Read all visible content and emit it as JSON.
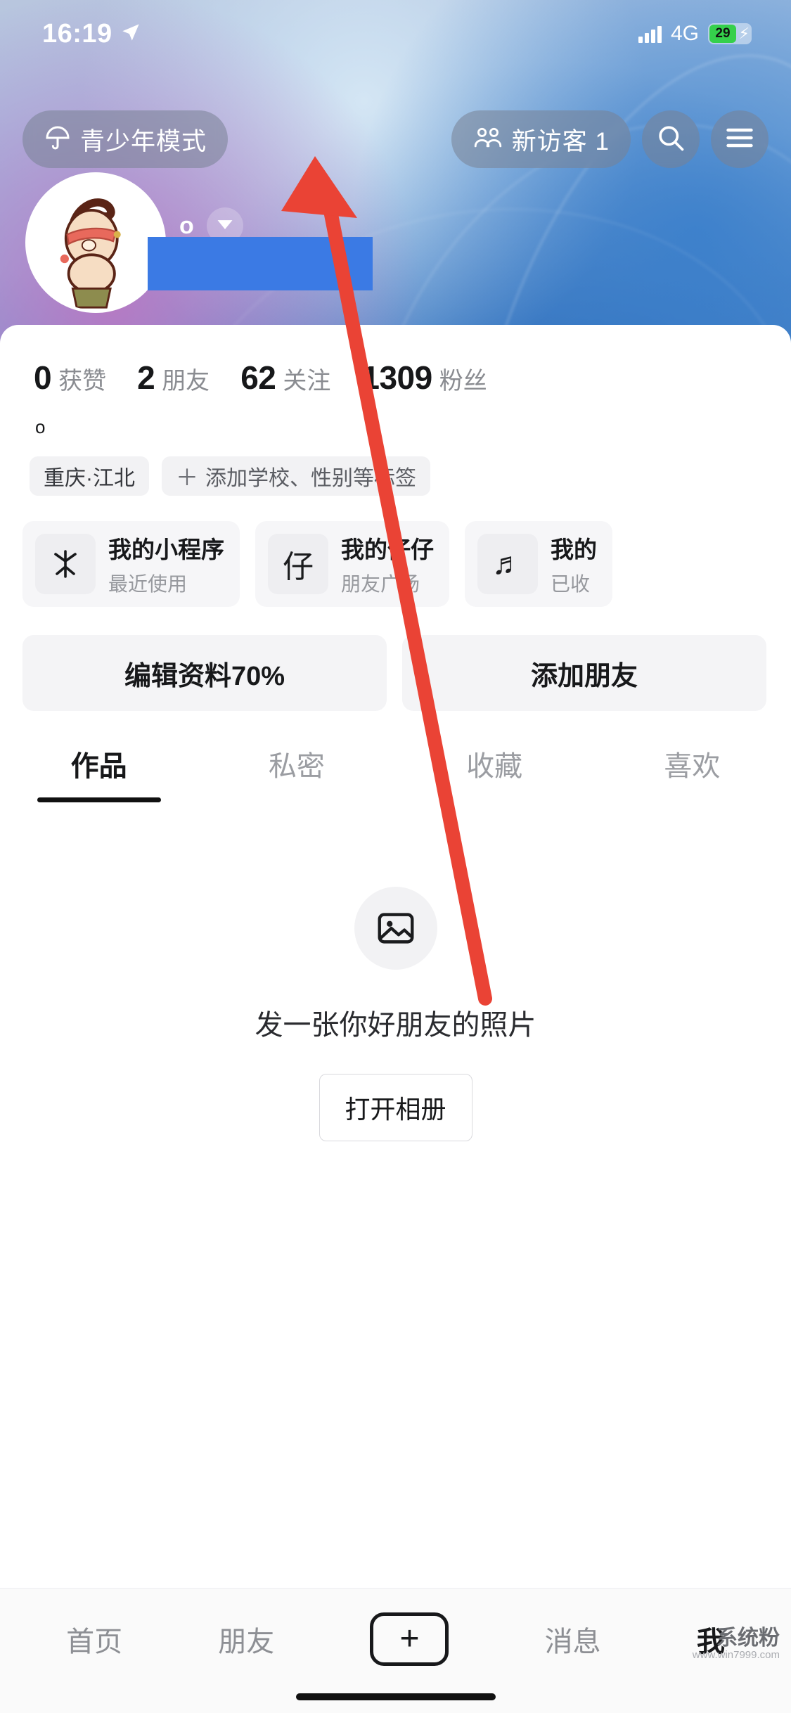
{
  "status_bar": {
    "time": "16:19",
    "location_icon": "location-arrow-icon",
    "network": "4G",
    "battery_percent": "29",
    "battery_state": "charging",
    "battery_color": "#35d04b"
  },
  "header": {
    "teen_mode_label": "青少年模式",
    "teen_mode_icon": "umbrella-icon",
    "visitors_label": "新访客 1",
    "visitors_icon": "people-icon",
    "search_icon": "search-icon",
    "menu_icon": "hamburger-menu-icon"
  },
  "profile": {
    "avatar_alt": "avatar",
    "name_redacted": true,
    "dropdown_icon": "chevron-down-icon",
    "bio": "o",
    "stats": [
      {
        "num": "0",
        "label": "获赞"
      },
      {
        "num": "2",
        "label": "朋友"
      },
      {
        "num": "62",
        "label": "关注"
      },
      {
        "num": "1309",
        "label": "粉丝"
      }
    ],
    "tags": [
      {
        "text": "重庆·江北",
        "type": "location"
      },
      {
        "text": "添加学校、性别等标签",
        "type": "add",
        "prefix": "＋"
      }
    ]
  },
  "cards": [
    {
      "icon": "douyin-logo-icon",
      "glyph": "✳",
      "title": "我的小程序",
      "subtitle": "最近使用"
    },
    {
      "icon": "zaizai-icon",
      "glyph": "仔",
      "title": "我的仔仔",
      "subtitle": "朋友广场"
    },
    {
      "icon": "music-note-icon",
      "glyph": "♬",
      "title": "我的",
      "subtitle": "已收"
    }
  ],
  "actions": [
    {
      "label": "编辑资料70%"
    },
    {
      "label": "添加朋友"
    }
  ],
  "tabs": [
    {
      "label": "作品",
      "active": true
    },
    {
      "label": "私密",
      "active": false
    },
    {
      "label": "收藏",
      "active": false
    },
    {
      "label": "喜欢",
      "active": false
    }
  ],
  "empty_state": {
    "icon": "image-placeholder-icon",
    "text": "发一张你好朋友的照片",
    "button_label": "打开相册"
  },
  "bottom_nav": [
    {
      "label": "首页",
      "active": false
    },
    {
      "label": "朋友",
      "active": false
    },
    {
      "label": "+",
      "type": "create",
      "active": false
    },
    {
      "label": "消息",
      "active": false
    },
    {
      "label": "我",
      "active": true
    }
  ],
  "annotation": {
    "type": "arrow",
    "color": "#ea4335",
    "points_to": "新访客 1"
  },
  "watermark": {
    "line1": "系统粉",
    "line2": "www.win7999.com"
  }
}
